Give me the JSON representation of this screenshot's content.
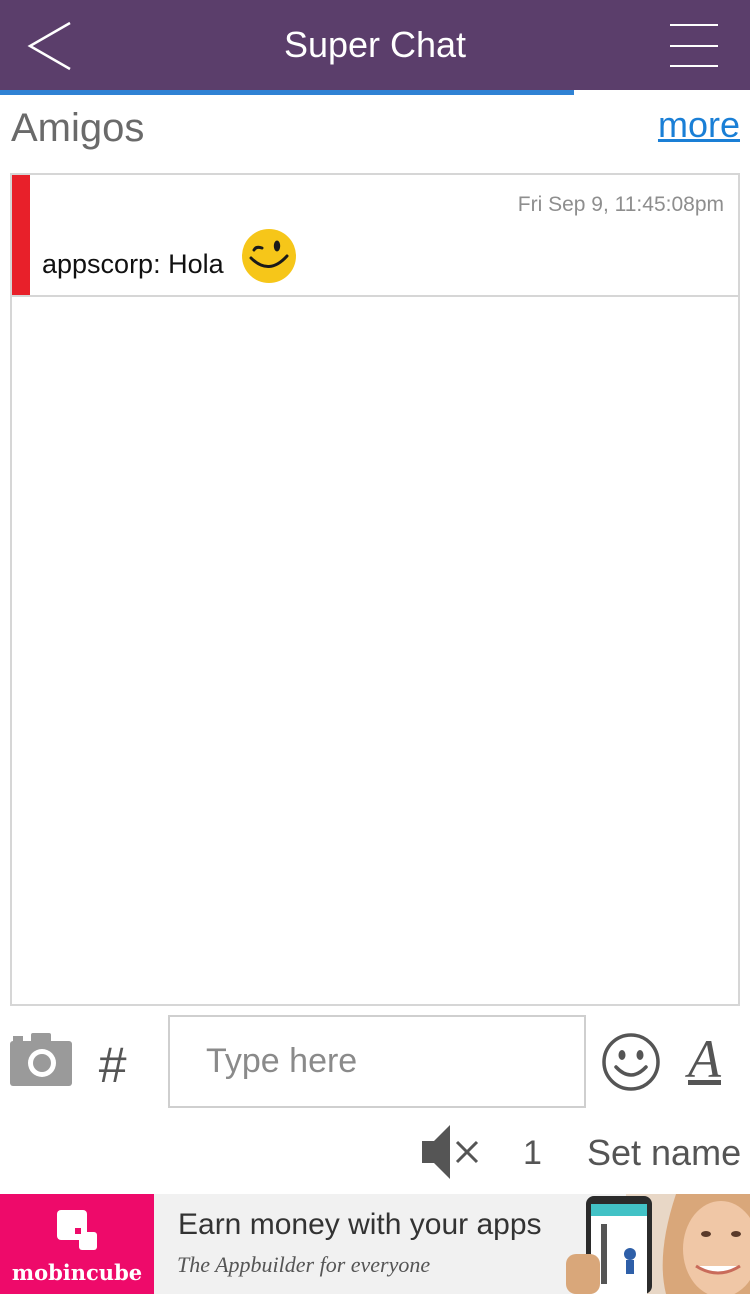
{
  "header": {
    "title": "Super Chat",
    "back_icon": "chevron-left-icon",
    "menu_icon": "hamburger-menu-icon",
    "background_color": "#5b3e6b"
  },
  "loading_progress": 0.765,
  "room": {
    "name": "Amigos",
    "more_label": "more"
  },
  "messages": [
    {
      "timestamp": "Fri Sep 9, 11:45:08pm",
      "text": "appscorp: Hola",
      "emoji": "wink-emoji-icon",
      "accent_color": "#e8202a"
    }
  ],
  "composer": {
    "placeholder": "Type here",
    "camera_icon": "camera-icon",
    "hash_label": "#",
    "smiley_icon": "smiley-icon",
    "font_label": "A"
  },
  "footer": {
    "mute_icon": "speaker-muted-icon",
    "count": "1",
    "set_name_label": "Set name"
  },
  "ad": {
    "brand": "mobincube",
    "headline": "Earn money with your apps",
    "subline": "The Appbuilder for everyone",
    "brand_color": "#ee0a6a"
  }
}
